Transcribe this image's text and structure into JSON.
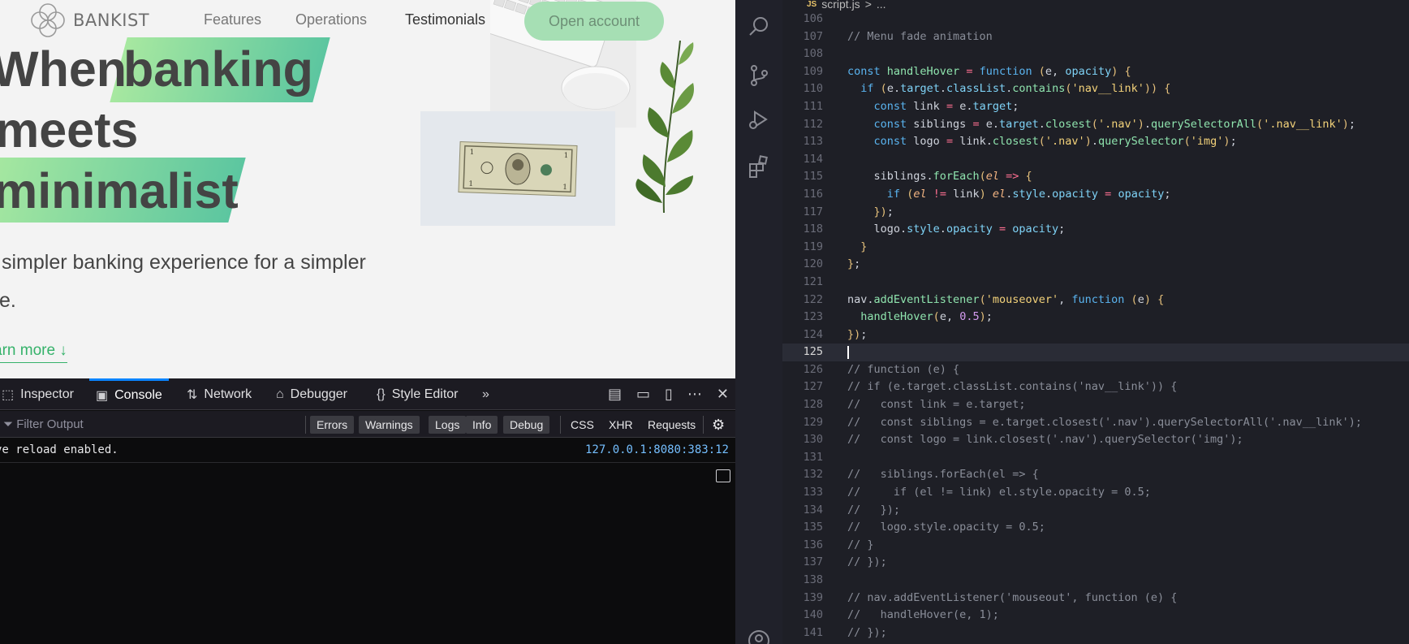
{
  "webpage": {
    "logo_text": "BANKIST",
    "nav_links": [
      "Features",
      "Operations",
      "Testimonials"
    ],
    "cta": "Open account",
    "hero_lines": [
      "When",
      "banking",
      "meets",
      "minimalist"
    ],
    "subtitle_lines": [
      "simpler banking experience for a simpler",
      "e."
    ],
    "learn_more": "arn more ↓"
  },
  "devtools": {
    "tabs": [
      {
        "label": "Inspector",
        "icon": "inspector-icon"
      },
      {
        "label": "Console",
        "icon": "console-icon"
      },
      {
        "label": "Network",
        "icon": "network-icon"
      },
      {
        "label": "Debugger",
        "icon": "debugger-icon"
      },
      {
        "label": "Style Editor",
        "icon": "style-editor-icon"
      }
    ],
    "filter_placeholder": "Filter Output",
    "filters": [
      "Errors",
      "Warnings",
      "Logs",
      "Info",
      "Debug"
    ],
    "filters_plain": [
      "CSS",
      "XHR",
      "Requests"
    ],
    "console_message": "ve reload enabled.",
    "console_source": "127.0.0.1:8080:383:12"
  },
  "editor": {
    "breadcrumb_file": "script.js",
    "breadcrumb_sep": ">",
    "breadcrumb_more": "...",
    "js_badge": "JS",
    "current_line": 125,
    "lines": [
      {
        "n": 106,
        "t": ""
      },
      {
        "n": 107,
        "t": "// Menu fade animation"
      },
      {
        "n": 108,
        "t": ""
      },
      {
        "n": 109,
        "t": "const handleHover = function (e, opacity) {"
      },
      {
        "n": 110,
        "t": "  if (e.target.classList.contains('nav__link')) {"
      },
      {
        "n": 111,
        "t": "    const link = e.target;"
      },
      {
        "n": 112,
        "t": "    const siblings = e.target.closest('.nav').querySelectorAll('.nav__link');"
      },
      {
        "n": 113,
        "t": "    const logo = link.closest('.nav').querySelector('img');"
      },
      {
        "n": 114,
        "t": ""
      },
      {
        "n": 115,
        "t": "    siblings.forEach(el => {"
      },
      {
        "n": 116,
        "t": "      if (el != link) el.style.opacity = opacity;"
      },
      {
        "n": 117,
        "t": "    });"
      },
      {
        "n": 118,
        "t": "    logo.style.opacity = opacity;"
      },
      {
        "n": 119,
        "t": "  }"
      },
      {
        "n": 120,
        "t": "};"
      },
      {
        "n": 121,
        "t": ""
      },
      {
        "n": 122,
        "t": "nav.addEventListener('mouseover', function (e) {"
      },
      {
        "n": 123,
        "t": "  handleHover(e, 0.5);"
      },
      {
        "n": 124,
        "t": "});"
      },
      {
        "n": 125,
        "t": ""
      },
      {
        "n": 126,
        "t": "// function (e) {"
      },
      {
        "n": 127,
        "t": "// if (e.target.classList.contains('nav__link')) {"
      },
      {
        "n": 128,
        "t": "//   const link = e.target;"
      },
      {
        "n": 129,
        "t": "//   const siblings = e.target.closest('.nav').querySelectorAll('.nav__link');"
      },
      {
        "n": 130,
        "t": "//   const logo = link.closest('.nav').querySelector('img');"
      },
      {
        "n": 131,
        "t": ""
      },
      {
        "n": 132,
        "t": "//   siblings.forEach(el => {"
      },
      {
        "n": 133,
        "t": "//     if (el != link) el.style.opacity = 0.5;"
      },
      {
        "n": 134,
        "t": "//   });"
      },
      {
        "n": 135,
        "t": "//   logo.style.opacity = 0.5;"
      },
      {
        "n": 136,
        "t": "// }"
      },
      {
        "n": 137,
        "t": "// });"
      },
      {
        "n": 138,
        "t": ""
      },
      {
        "n": 139,
        "t": "// nav.addEventListener('mouseout', function (e) {"
      },
      {
        "n": 140,
        "t": "//   handleHover(e, 1);"
      },
      {
        "n": 141,
        "t": "// });"
      }
    ]
  },
  "colors": {
    "accent_green": "#35b26a",
    "devtools_accent": "#0a84ff",
    "editor_bg": "#1e1f26"
  }
}
